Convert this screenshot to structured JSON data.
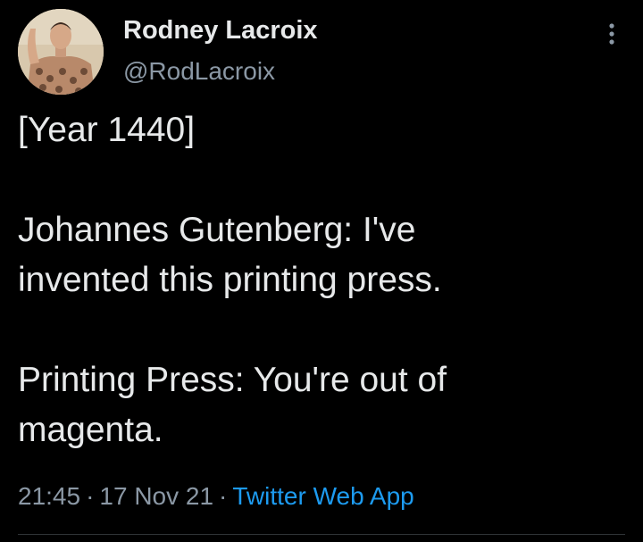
{
  "author": {
    "name": "Rodney Lacroix",
    "handle": "@RodLacroix"
  },
  "more_icon": "more-vertical-icon",
  "tweet": {
    "lines": [
      "[Year 1440]",
      "",
      "Johannes Gutenberg: I've",
      "invented this printing press.",
      "",
      "Printing Press: You're out of",
      "magenta."
    ]
  },
  "meta": {
    "time": "21:45",
    "date": "17 Nov 21",
    "separator": "·",
    "source": "Twitter Web App"
  },
  "colors": {
    "background": "#000000",
    "text": "#e7e9ea",
    "secondary": "#8b98a5",
    "link": "#1d9bf0",
    "divider": "#2f3336"
  }
}
